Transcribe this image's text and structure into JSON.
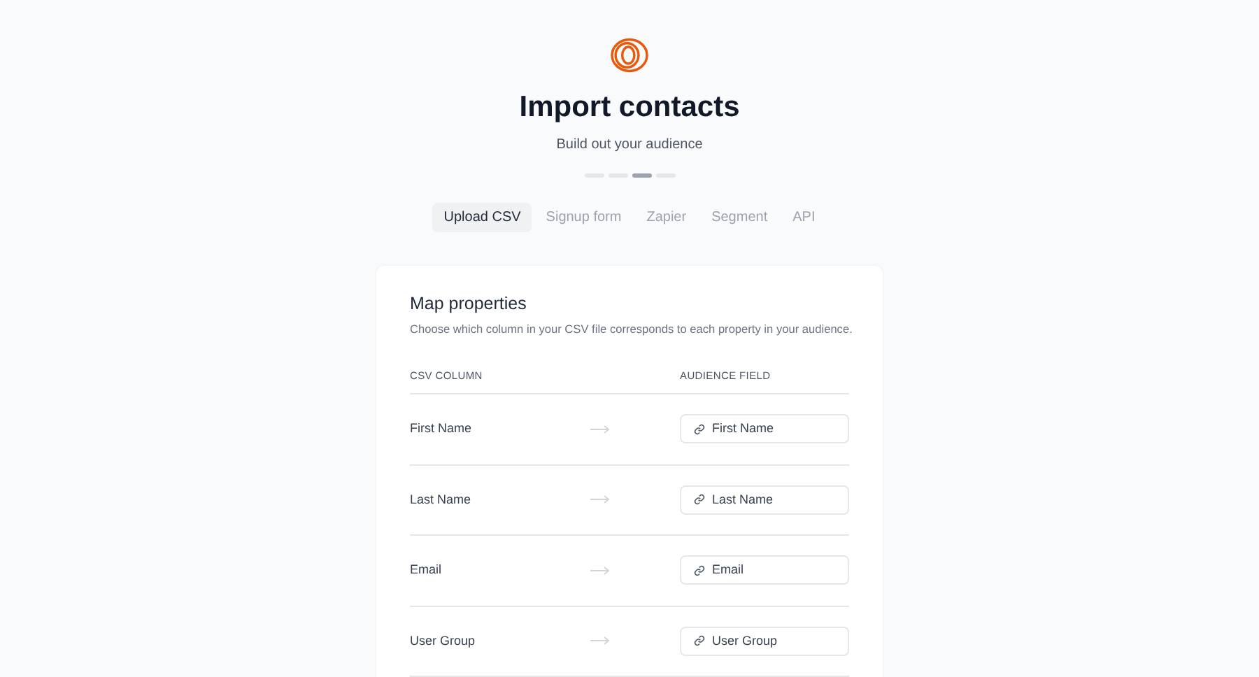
{
  "title": "Import contacts",
  "subtitle": "Build out your audience",
  "steps": [
    {
      "selected": false
    },
    {
      "selected": false
    },
    {
      "selected": true
    },
    {
      "selected": false
    }
  ],
  "tabs": [
    {
      "label": "Upload CSV",
      "selected": true
    },
    {
      "label": "Signup form",
      "selected": false
    },
    {
      "label": "Zapier",
      "selected": false
    },
    {
      "label": "Segment",
      "selected": false
    },
    {
      "label": "API",
      "selected": false
    }
  ],
  "card": {
    "title": "Map properties",
    "description": "Choose which column in your CSV file corresponds to each property in your audience.",
    "columns": [
      "CSV COLUMN",
      "AUDIENCE FIELD"
    ],
    "rows": [
      {
        "csv_column": "First Name",
        "audience_field": "First Name"
      },
      {
        "csv_column": "Last Name",
        "audience_field": "Last Name"
      },
      {
        "csv_column": "Email",
        "audience_field": "Email"
      },
      {
        "csv_column": "User Group",
        "audience_field": "User Group"
      }
    ]
  }
}
